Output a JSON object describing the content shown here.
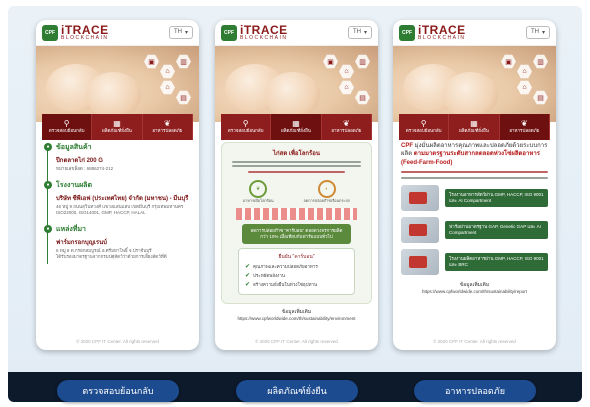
{
  "brand": {
    "logo_text": "CPF",
    "title": "iTRACE",
    "subtitle": "BLOCKCHAIN"
  },
  "language": {
    "value": "TH",
    "arrow": "▾"
  },
  "tabs": [
    {
      "label": "ตรวจสอบย้อนกลับ",
      "icon": "⚲"
    },
    {
      "label": "ผลิตภัณฑ์ยั่งยืน",
      "icon": "▦"
    },
    {
      "label": "อาหารปลอดภัย",
      "icon": "❦"
    }
  ],
  "trace": {
    "product_title": "ข้อมูลสินค้า",
    "product_name": "ปีกตลาดไก่ 200 G",
    "product_lot": "หมายเลขล็อต : 6886274-212",
    "factory_title": "โรงงานผลิต",
    "factory_name": "บริษัท ซีพีเอฟ (ประเทศไทย) จำกัด (มหาชน) - มีนบุรี",
    "factory_addr": "46 หมู่ 9 ถนนสุวินทวงศ์ แขวงแสนแสบ เขตมีนบุรี กรุงเทพมหานคร",
    "factory_cert": "ISO22000, ISO14001, GMP, HACCP, HALAL",
    "farm_title": "แหล่งที่มา",
    "farm_name": "ฟาร์มกรอกบุญเรนบ์",
    "farm_addr": "6 หมู่ 8 ต.กรอกสมบูรณ์ อ.ศรีมหาโพธิ์ จ.ปราจีนบุรี",
    "farm_note": "ได้รับรองมาตรฐานจากกรมปศุสัตว์ว่าด้วยการเลี้ยงสัตว์ที่ดี"
  },
  "sustain": {
    "card_title": "ไก่สด เพื่อโลกร้อน",
    "badge1": "อาหารเพื่อโลกร้อน",
    "badge2": "ลดการปล่อยก๊าซเรือนกระจก",
    "green_box": "ลดการปล่อยก๊าซ \"คาร์บอน\" ตลอดวงจรการผลิตกว่า 10% เมื่อเทียบกับฟาร์มแบบทั่วไป",
    "check_title": "ยืนยัน \"คาร์บอน\"",
    "checks": [
      "คุณภาพและความปลอดภัยอาหาร",
      "ประหยัดพลังงาน",
      "สร้างความยั่งยืนในห่วงโซ่อุปทาน"
    ],
    "url_label": "ข้อมูลเพิ่มเติม",
    "url": "https://www.cpfworldwide.com/th/sustainability/environment"
  },
  "safety": {
    "lead_cpf": "CPF",
    "lead_1": "มุ่งมั่นผลิตอาหารคุณภาพและปลอดภัยด้วยระบบการผลิต",
    "lead_2": "ตามมาตรฐานระดับสากลตลอดห่วงโซ่ผลิตอาหาร",
    "lead_3": "(Feed-Farm-Food)",
    "items": [
      "โรงงานอาหารสัตว์ผ่าน GMP, HACCP, ISO 9001 และ AI Compartment",
      "ฟาร์มผ่านมาตรฐาน GAP, Genetic GAP และ AI Compartment",
      "โรงงานผลิตอาหารผ่าน GMP, HACCP, ISO 9001 และ BRC"
    ],
    "url_label": "ข้อมูลเพิ่มเติม",
    "url": "https://www.cpfworldwide.com/th/sustainability/report"
  },
  "footer": "© 2020 CPF IT Center. All rights reserved",
  "bottom_buttons": [
    "ตรวจสอบย้อนกลับ",
    "ผลิตภัณฑ์ยั่งยืน",
    "อาหารปลอดภัย"
  ]
}
